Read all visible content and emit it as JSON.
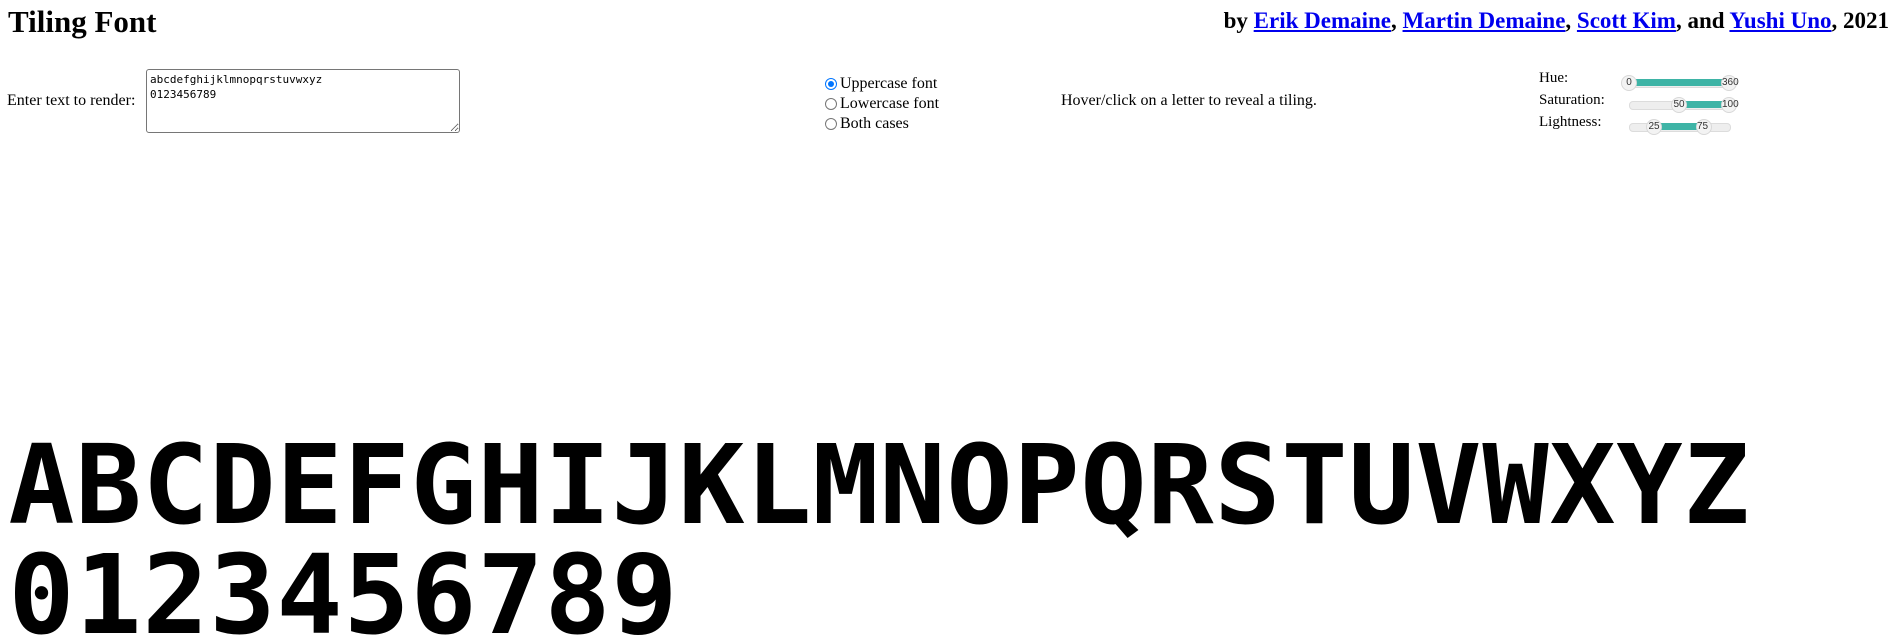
{
  "header": {
    "title": "Tiling Font",
    "by": "by ",
    "authors": [
      "Erik Demaine",
      "Martin Demaine",
      "Scott Kim",
      "Yushi Uno"
    ],
    "sep1": ", ",
    "sep2": ", ",
    "sep3": ", and ",
    "year": ", 2021"
  },
  "input": {
    "label": "Enter text to render:",
    "value": "abcdefghijklmnopqrstuvwxyz\n0123456789"
  },
  "font_options": {
    "selected": "Uppercase font",
    "options": [
      "Uppercase font",
      "Lowercase font",
      "Both cases"
    ]
  },
  "hint": "Hover/click on a letter to reveal a tiling.",
  "sliders": {
    "hue": {
      "label": "Hue:",
      "min_value": "0",
      "max_value": "360",
      "low": 0,
      "high": 1
    },
    "saturation": {
      "label": "Saturation:",
      "min_value": "50",
      "max_value": "100",
      "low": 0.5,
      "high": 1
    },
    "lightness": {
      "label": "Lightness:",
      "min_value": "25",
      "max_value": "75",
      "low": 0.25,
      "high": 0.75
    }
  },
  "rendered": {
    "line1": [
      "A",
      "B",
      "C",
      "D",
      "E",
      "F",
      "G",
      "H",
      "I",
      "J",
      "K",
      "L",
      "M",
      "N",
      "O",
      "P",
      "Q",
      "R",
      "S",
      "T",
      "U",
      "V",
      "W",
      "X",
      "Y",
      "Z"
    ],
    "line2": [
      "0",
      "1",
      "2",
      "3",
      "4",
      "5",
      "6",
      "7",
      "8",
      "9"
    ]
  }
}
